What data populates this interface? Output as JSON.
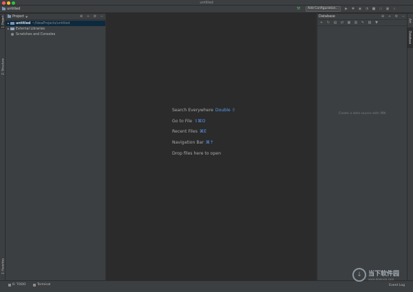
{
  "window": {
    "title": "untitled"
  },
  "navbar": {
    "project_name": "untitled",
    "add_configuration": "Add Configuration..."
  },
  "left_strip": {
    "project_tab": "1: Project",
    "structure_tab": "Z: Structure",
    "favorites_tab": "2: Favorites"
  },
  "project_panel": {
    "title": "Project",
    "tree": [
      {
        "name": "untitled",
        "path": "~/IdeaProjects/untitled"
      },
      {
        "name": "External Libraries"
      },
      {
        "name": "Scratches and Consoles"
      }
    ]
  },
  "editor": {
    "hints": [
      {
        "label": "Search Everywhere",
        "shortcut": "Double ⇧"
      },
      {
        "label": "Go to File",
        "shortcut": "⇧⌘O"
      },
      {
        "label": "Recent Files",
        "shortcut": "⌘E"
      },
      {
        "label": "Navigation Bar",
        "shortcut": "⌘↑"
      },
      {
        "label": "Drop files here to open",
        "shortcut": ""
      }
    ]
  },
  "database_panel": {
    "title": "Database",
    "empty_text": "Create a data source with ⌘N"
  },
  "right_strip": {
    "ant_tab": "Ant",
    "database_tab": "Database"
  },
  "bottom_bar": {
    "todo": "6: TODO",
    "terminal": "Terminal",
    "event_log": "Event Log"
  },
  "watermark": {
    "cn": "当下软件园",
    "en": "www.downxia.com"
  }
}
